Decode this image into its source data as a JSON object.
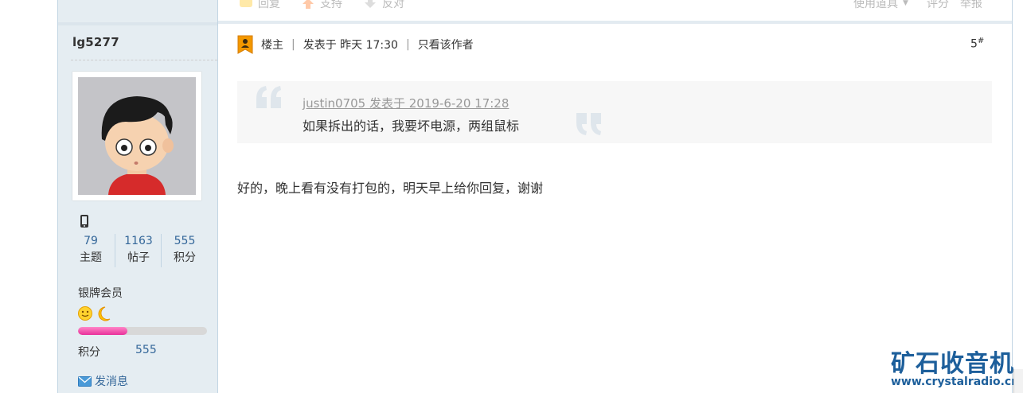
{
  "author": {
    "name": "lg5277",
    "stats": [
      {
        "value": "79",
        "label": "主题"
      },
      {
        "value": "1163",
        "label": "帖子"
      },
      {
        "value": "555",
        "label": "积分"
      }
    ],
    "group": "银牌会员",
    "level_progress": 0.38,
    "points_label": "积分",
    "points_value": "555",
    "send_message": "发消息"
  },
  "action_bar": {
    "reply": "回复",
    "support": "支持",
    "oppose": "反对",
    "tools": "使用道具",
    "rate": "评分",
    "report": "举报"
  },
  "post": {
    "op_label": "楼主",
    "posted_at": "发表于 昨天 17:30",
    "only_author": "只看该作者",
    "floor": "5",
    "floor_sup": "#",
    "quote_ref": "justin0705 发表于 2019-6-20 17:28",
    "quote_text": "如果拆出的话，我要坏电源，两组鼠标",
    "reply_text": "好的，晚上看有没有打包的，明天早上给你回复，谢谢"
  },
  "watermark": {
    "title": "矿石收音机",
    "url": "www.crystalradio.cn"
  },
  "colors": {
    "link": "#336699",
    "sidebar_bg": "#e5edf2",
    "border": "#c2d5e3",
    "level_fill": "#e8309a",
    "watermark": "#1d5f9b"
  }
}
